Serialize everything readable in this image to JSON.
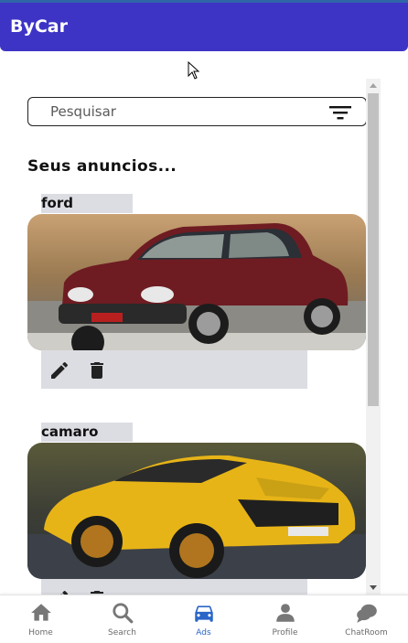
{
  "app": {
    "title": "ByCar"
  },
  "search": {
    "placeholder": "Pesquisar"
  },
  "section": {
    "title": "Seus anuncios..."
  },
  "ads": [
    {
      "name": "ford"
    },
    {
      "name": "camaro"
    }
  ],
  "icons": {
    "filter": "filter-icon",
    "edit": "pencil-icon",
    "delete": "trash-icon"
  },
  "nav": {
    "active_color": "#2b66c8",
    "items": [
      {
        "label": "Home",
        "icon": "home-icon"
      },
      {
        "label": "Search",
        "icon": "search-icon"
      },
      {
        "label": "Ads",
        "icon": "car-icon"
      },
      {
        "label": "Profile",
        "icon": "profile-icon"
      },
      {
        "label": "ChatRoom",
        "icon": "chat-icon"
      }
    ]
  },
  "colors": {
    "appbar": "#3d34c6",
    "card_label_bg": "#dcdde3"
  }
}
